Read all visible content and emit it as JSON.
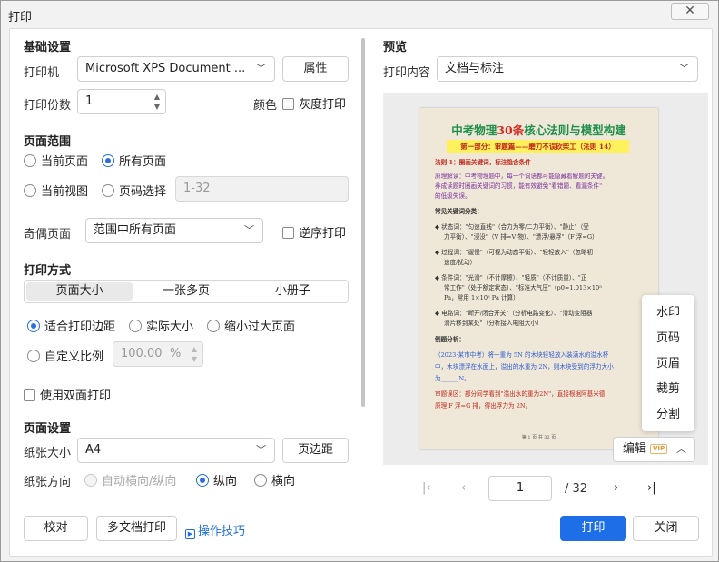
{
  "window": {
    "title": "打印",
    "close_glyph": "✕"
  },
  "basic": {
    "title": "基础设置",
    "printer_label": "打印机",
    "printer_value": "Microsoft XPS Document ...",
    "properties_btn": "属性",
    "copies_label": "打印份数",
    "copies_value": "1",
    "color_label": "颜色",
    "grayscale_label": "灰度打印"
  },
  "range": {
    "title": "页面范围",
    "current_page": "当前页面",
    "all_pages": "所有页面",
    "current_view": "当前视图",
    "page_select": "页码选择",
    "page_select_value": "1-32",
    "odd_even_label": "奇偶页面",
    "odd_even_value": "范围中所有页面",
    "reverse_label": "逆序打印"
  },
  "mode": {
    "title": "打印方式",
    "tabs": [
      "页面大小",
      "一张多页",
      "小册子"
    ],
    "fit_margin": "适合打印边距",
    "actual_size": "实际大小",
    "shrink_large": "缩小过大页面",
    "custom_scale": "自定义比例",
    "custom_scale_value": "100.00",
    "percent": "%",
    "duplex": "使用双面打印"
  },
  "page_setup": {
    "title": "页面设置",
    "paper_size_label": "纸张大小",
    "paper_size_value": "A4",
    "margin_btn": "页边距",
    "orientation_label": "纸张方向",
    "auto_orientation": "自动横向/纵向",
    "portrait": "纵向",
    "landscape": "横向"
  },
  "preview": {
    "title": "预览",
    "content_label": "打印内容",
    "content_value": "文档与标注",
    "doc": {
      "title_green_1": "中考物理",
      "title_red": "30",
      "title_red_2": "条",
      "title_green_2": "核心法则与模型构建",
      "subtitle": "第一部分：审题篇——磨刀不误砍柴工（法则 14）",
      "lines": [
        "法则 1：圈画关键词，标注隐含条件",
        "原理解读：中考物理题中，每一个词语都可能隐藏着解题的关键。",
        "养成读题时圈画关键词的习惯，能有效避免\"看错题、看漏条件\"",
        "的低级失误。",
        "常见关键词分类：",
        "◆ 状态词：\"匀速直线\"（合力为零/二力平衡）、\"静止\"（受",
        "力平衡）、\"浸没\"（V 排=V 物）、\"漂浮/悬浮\"（F 浮=G）",
        "◆ 过程词：\"缓慢\"（可视为动态平衡）、\"轻轻放入\"（忽略初",
        "速度/扰动）",
        "◆ 条件词：\"光滑\"（不计摩擦）、\"轻质\"（不计质量）、\"正",
        "常工作\"（处于额定状态）、\"标准大气压\"（p0=1.013×10⁵",
        "Pa，常用 1×10⁵ Pa 计算）",
        "◆ 电路词：\"断开/闭合开关\"（分析电路变化）、\"滑动变阻器",
        "滑片移到某处\"（分析接入电阻大小）",
        "例题分析：",
        "（2023·某市中考）将一重为 5N 的木块轻轻放入装满水的溢水杯",
        "中，木块漂浮在水面上，溢出的水重为 2N，则木块受到的浮力大小",
        "为______N。",
        "审题误区：部分同学看到\"溢出水的重为2N\"，直接根据阿基米德",
        "原理 F 浮=G 排，得出浮力为 2N。"
      ],
      "footer": "第 1 页 共 32 页"
    },
    "menu_items": [
      "水印",
      "页码",
      "页眉",
      "裁剪",
      "分割"
    ],
    "edit_btn": "编辑",
    "vip_badge": "VIP",
    "pager": {
      "first": "|‹",
      "prev": "‹",
      "current": "1",
      "total": "/ 32",
      "next": "›",
      "last": "›|"
    }
  },
  "footer": {
    "proof_btn": "校对",
    "multi_doc_btn": "多文档打印",
    "tips_link": "操作技巧",
    "print_btn": "打印",
    "close_btn": "关闭"
  }
}
